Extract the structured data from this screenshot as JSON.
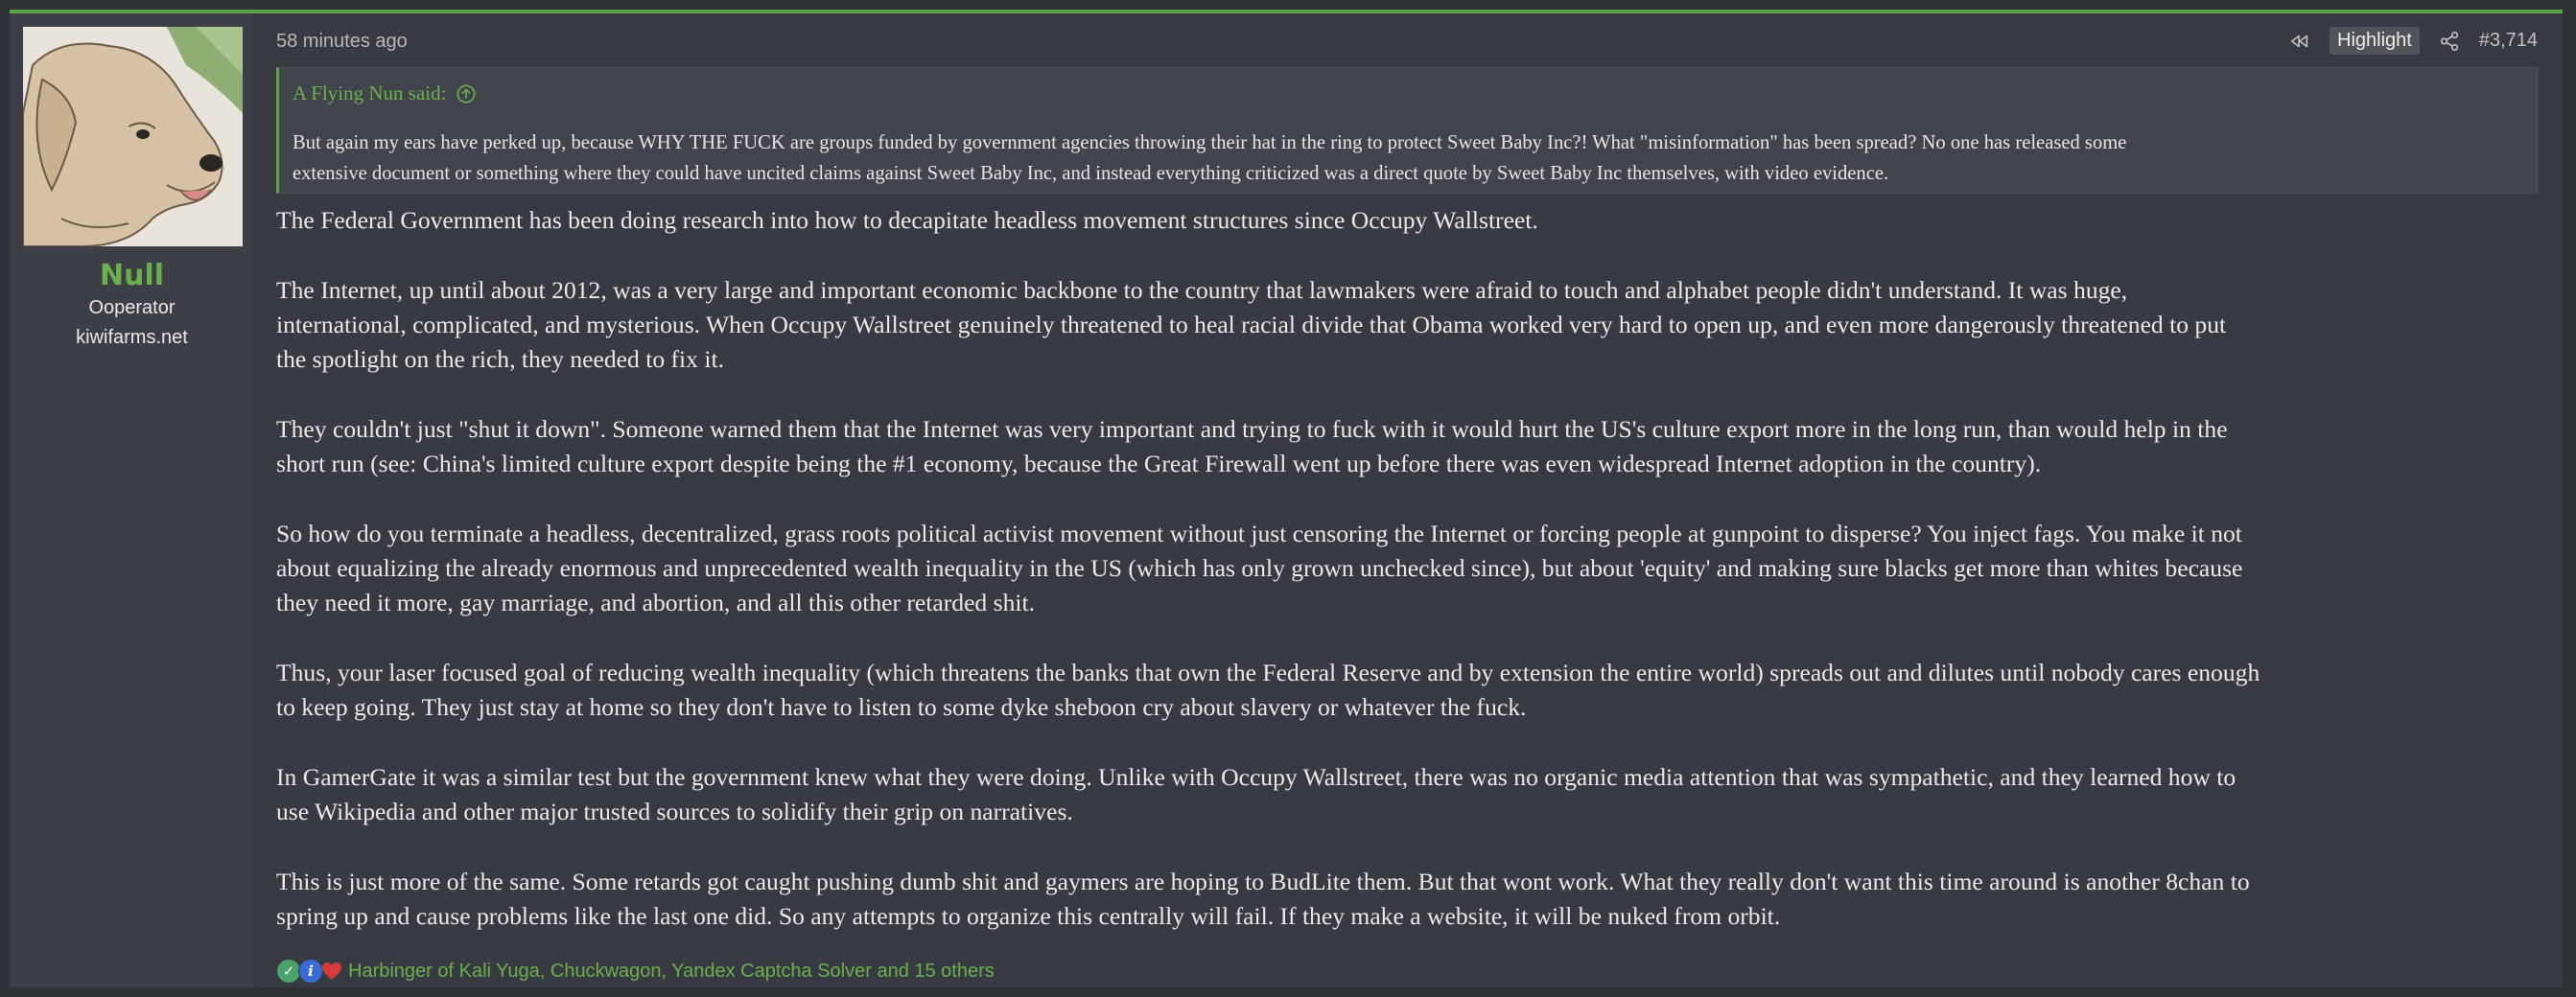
{
  "user": {
    "name": "Null",
    "title": "Ooperator",
    "site": "kiwifarms.net",
    "avatar_alt": "dog-avatar"
  },
  "post": {
    "time": "58 minutes ago",
    "highlight_label": "Highlight",
    "number": "#3,714"
  },
  "quote": {
    "author": "A Flying Nun said:",
    "lines": [
      "But again my ears have perked up, because WHY THE FUCK are groups funded by government agencies throwing their hat in the ring to protect Sweet Baby Inc?! What \"misinformation\" has been spread? No one has released some",
      "extensive document or something where they could have uncited claims against Sweet Baby Inc, and instead everything criticized was a direct quote by Sweet Baby Inc themselves, with video evidence."
    ]
  },
  "body": {
    "paragraphs": [
      [
        "The Federal Government has been doing research into how to decapitate headless movement structures since Occupy Wallstreet."
      ],
      [
        "The Internet, up until about 2012, was a very large and important economic backbone to the country that lawmakers were afraid to touch and alphabet people didn't understand. It was huge,",
        "international, complicated, and mysterious. When Occupy Wallstreet genuinely threatened to heal racial divide that Obama worked very hard to open up, and even more dangerously threatened to put",
        "the spotlight on the rich, they needed to fix it."
      ],
      [
        "They couldn't just \"shut it down\". Someone warned them that the Internet was very important and trying to fuck with it would hurt the US's culture export more in the long run, than would help in the",
        "short run (see: China's limited culture export despite being the #1 economy, because the Great Firewall went up before there was even widespread Internet adoption in the country)."
      ],
      [
        "So how do you terminate a headless, decentralized, grass roots political activist movement without just censoring the Internet or forcing people at gunpoint to disperse? You inject fags. You make it not",
        "about equalizing the already enormous and unprecedented wealth inequality in the US (which has only grown unchecked since), but about 'equity' and making sure blacks get more than whites because",
        "they need it more, gay marriage, and abortion, and all this other retarded shit."
      ],
      [
        "Thus, your laser focused goal of reducing wealth inequality (which threatens the banks that own the Federal Reserve and by extension the entire world) spreads out and dilutes until nobody cares enough",
        "to keep going. They just stay at home so they don't have to listen to some dyke sheboon cry about slavery or whatever the fuck."
      ],
      [
        "In GamerGate it was a similar test but the government knew what they were doing. Unlike with Occupy Wallstreet, there was no organic media attention that was sympathetic, and they learned how to",
        "use Wikipedia and other major trusted sources to solidify their grip on narratives."
      ],
      [
        "This is just more of the same. Some retards got caught pushing dumb shit and gaymers are hoping to BudLite them. But that wont work. What they really don't want this time around is another 8chan to",
        "spring up and cause problems like the last one did. So any attempts to organize this centrally will fail. If they make a website, it will be nuked from orbit."
      ]
    ]
  },
  "reactions": {
    "text": "Harbinger of Kali Yuga, Chuckwagon, Yandex Captcha Solver and 15 others",
    "icons": [
      "check-reaction-icon",
      "info-reaction-icon",
      "heart-reaction-icon"
    ],
    "accent": "#6ab04c"
  },
  "colors": {
    "accent": "#5aa34b",
    "background": "#2f3237",
    "post_bg": "#373a40"
  }
}
